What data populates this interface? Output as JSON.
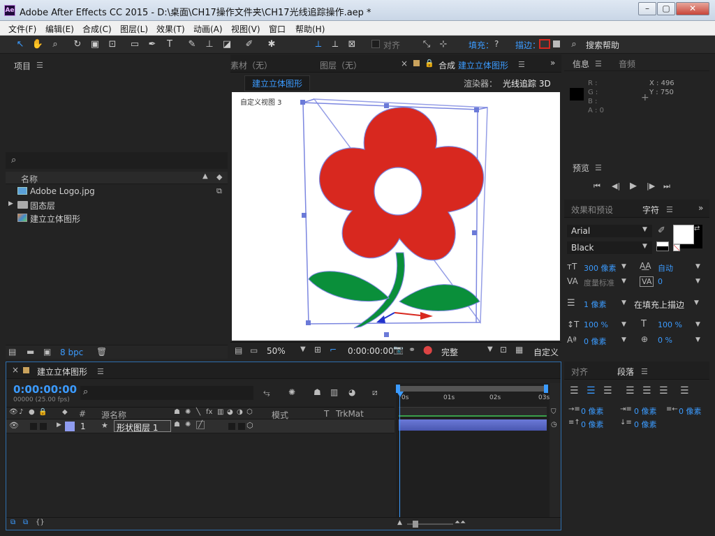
{
  "window": {
    "title": "Adobe After Effects CC 2015 - D:\\桌面\\CH17操作文件夹\\CH17光线追踪操作.aep *",
    "logo": "Ae"
  },
  "menu": [
    "文件(F)",
    "编辑(E)",
    "合成(C)",
    "图层(L)",
    "效果(T)",
    "动画(A)",
    "视图(V)",
    "窗口",
    "帮助(H)"
  ],
  "toolbar": {
    "align_label": "对齐",
    "fill_label": "填充：",
    "fill_value": "?",
    "stroke_label": "描边：",
    "search_help": "搜索帮助"
  },
  "project": {
    "title": "项目",
    "column_name": "名称",
    "items": [
      {
        "name": "Adobe Logo.jpg",
        "icon": "image-icon"
      },
      {
        "name": "固态层",
        "icon": "folder-icon"
      },
      {
        "name": "建立立体图形",
        "icon": "composition-icon"
      }
    ],
    "bpc": "8 bpc"
  },
  "viewer": {
    "tabs": [
      {
        "label": "素材（无）"
      },
      {
        "label": "图层（无）"
      },
      {
        "label": "合成",
        "value": "建立立体图形"
      }
    ],
    "comp_chip": "建立立体图形",
    "renderer_label": "渲染器：",
    "renderer_value": "光线追踪 3D",
    "view_label": "自定义视图 3",
    "zoom": "50%",
    "timecode": "0:00:00:00",
    "quality": "完整",
    "view_menu": "自定义"
  },
  "info": {
    "tabs": [
      "信息",
      "音频"
    ],
    "r": "R :",
    "g": "G :",
    "b": "B :",
    "a": "A : 0",
    "x": "X : 496",
    "y": "Y : 750"
  },
  "preview": {
    "title": "预览"
  },
  "character": {
    "tabs": [
      "效果和预设",
      "字符"
    ],
    "font": "Arial",
    "style": "Black",
    "size": "300 像素",
    "leading": "自动",
    "kerning": "度量标准",
    "tracking": "0",
    "stroke_width": "1 像素",
    "stroke_mode": "在填充上描边",
    "vscale": "100 %",
    "hscale": "100 %",
    "baseline": "0 像素",
    "tsume": "0 %"
  },
  "paragraph": {
    "tabs": [
      "对齐",
      "段落"
    ],
    "indent_left": "0 像素",
    "indent_first": "0 像素",
    "indent_right": "0 像素",
    "space_before": "0 像素",
    "space_after": "0 像素"
  },
  "timeline": {
    "title": "建立立体图形",
    "timecode": "0:00:00:00",
    "fps": "00000 (25.00 fps)",
    "col_num": "#",
    "col_name": "源名称",
    "col_mode": "模式",
    "col_t": "T",
    "col_trkmat": "TrkMat",
    "ruler": [
      "0s",
      "01s",
      "02s",
      "03s"
    ],
    "layers": [
      {
        "num": "1",
        "name": "形状图层 1",
        "label_color": "#8f9cf0"
      }
    ]
  },
  "colors": {
    "flower_red": "#d8281f",
    "leaf_green": "#0a8f3a",
    "accent_blue": "#3b9bff",
    "layer_bar": "#6b7ad8"
  }
}
